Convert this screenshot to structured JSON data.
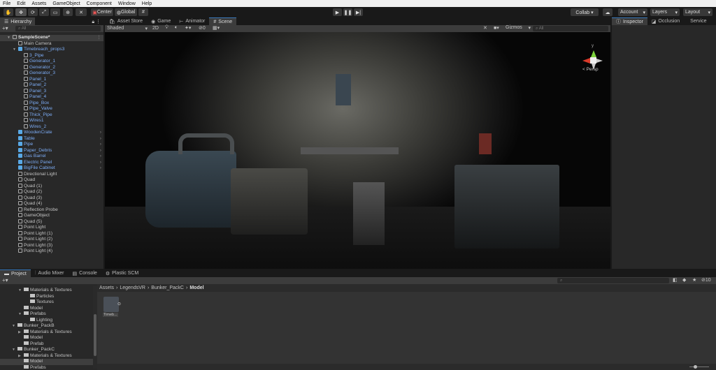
{
  "menu": [
    "File",
    "Edit",
    "Assets",
    "GameObject",
    "Component",
    "Window",
    "Help"
  ],
  "toolbar": {
    "center": "Center",
    "global": "Global",
    "collab": "Collab ▾",
    "account": "Account",
    "layers": "Layers",
    "layout": "Layout"
  },
  "hierarchy": {
    "title": "Hierarchy",
    "search_placeholder": "All",
    "items": [
      {
        "label": "SampleScene*",
        "depth": 0,
        "type": "scene",
        "expanded": true
      },
      {
        "label": "Main Camera",
        "depth": 1,
        "type": "go"
      },
      {
        "label": "Timebreach_props3",
        "depth": 1,
        "type": "prefab",
        "expanded": true
      },
      {
        "label": "3_Pipe",
        "depth": 2,
        "type": "child"
      },
      {
        "label": "Generator_1",
        "depth": 2,
        "type": "child"
      },
      {
        "label": "Generator_2",
        "depth": 2,
        "type": "child"
      },
      {
        "label": "Generator_3",
        "depth": 2,
        "type": "child"
      },
      {
        "label": "Panel_1",
        "depth": 2,
        "type": "child"
      },
      {
        "label": "Panel_2",
        "depth": 2,
        "type": "child"
      },
      {
        "label": "Panel_3",
        "depth": 2,
        "type": "child"
      },
      {
        "label": "Panel_4",
        "depth": 2,
        "type": "child"
      },
      {
        "label": "Pipe_Box",
        "depth": 2,
        "type": "child"
      },
      {
        "label": "Pipe_Valve",
        "depth": 2,
        "type": "child"
      },
      {
        "label": "Thick_Pipe",
        "depth": 2,
        "type": "child"
      },
      {
        "label": "Wires1",
        "depth": 2,
        "type": "child"
      },
      {
        "label": "Wires_2",
        "depth": 2,
        "type": "child"
      },
      {
        "label": "WoodenCrate",
        "depth": 1,
        "type": "prefab",
        "chev": true
      },
      {
        "label": "Table",
        "depth": 1,
        "type": "prefab",
        "chev": true
      },
      {
        "label": "Pipe",
        "depth": 1,
        "type": "prefab",
        "chev": true
      },
      {
        "label": "Paper_Debris",
        "depth": 1,
        "type": "prefab",
        "chev": true
      },
      {
        "label": "Gas Barrel",
        "depth": 1,
        "type": "prefab",
        "chev": true
      },
      {
        "label": "Electric Panel",
        "depth": 1,
        "type": "prefab",
        "chev": true
      },
      {
        "label": "BigFile Cabinet",
        "depth": 1,
        "type": "prefab",
        "chev": true
      },
      {
        "label": "Directional Light",
        "depth": 1,
        "type": "go"
      },
      {
        "label": "Quad",
        "depth": 1,
        "type": "go"
      },
      {
        "label": "Quad (1)",
        "depth": 1,
        "type": "go"
      },
      {
        "label": "Quad (2)",
        "depth": 1,
        "type": "go"
      },
      {
        "label": "Quad (3)",
        "depth": 1,
        "type": "go"
      },
      {
        "label": "Quad (4)",
        "depth": 1,
        "type": "go"
      },
      {
        "label": "Reflection Probe",
        "depth": 1,
        "type": "go"
      },
      {
        "label": "GameObject",
        "depth": 1,
        "type": "go"
      },
      {
        "label": "Quad (5)",
        "depth": 1,
        "type": "go"
      },
      {
        "label": "Point Light",
        "depth": 1,
        "type": "go"
      },
      {
        "label": "Point Light (1)",
        "depth": 1,
        "type": "go"
      },
      {
        "label": "Point Light (2)",
        "depth": 1,
        "type": "go"
      },
      {
        "label": "Point Light (3)",
        "depth": 1,
        "type": "go"
      },
      {
        "label": "Point Light (4)",
        "depth": 1,
        "type": "go"
      }
    ]
  },
  "scene_tabs": [
    "Asset Store",
    "Game",
    "Animator",
    "Scene"
  ],
  "scene_toolbar": {
    "shading": "Shaded",
    "mode2d": "2D",
    "hidden_count": "0",
    "gizmos": "Gizmos",
    "search_placeholder": "All"
  },
  "gizmo": {
    "y_axis": "y",
    "persp": "< Persp"
  },
  "inspector_tabs": [
    "Inspector",
    "Occlusion",
    "Service"
  ],
  "bottom_tabs": [
    "Project",
    "Audio Mixer",
    "Console",
    "Plastic SCM"
  ],
  "project": {
    "tree": [
      {
        "label": "Materials & Textures",
        "depth": 1,
        "open": true
      },
      {
        "label": "Particles",
        "depth": 2
      },
      {
        "label": "Textures",
        "depth": 2
      },
      {
        "label": "Model",
        "depth": 1
      },
      {
        "label": "Prefabs",
        "depth": 1,
        "open": true
      },
      {
        "label": "Lighting",
        "depth": 2
      },
      {
        "label": "Bunker_PackB",
        "depth": 0,
        "open": true
      },
      {
        "label": "Materials & Textures",
        "depth": 1,
        "closed": true
      },
      {
        "label": "Model",
        "depth": 1
      },
      {
        "label": "Prefab",
        "depth": 1
      },
      {
        "label": "Bunker_PackC",
        "depth": 0,
        "open": true
      },
      {
        "label": "Materials & Textures",
        "depth": 1,
        "closed": true
      },
      {
        "label": "Model",
        "depth": 1,
        "selected": true
      },
      {
        "label": "Prefabs",
        "depth": 1
      }
    ],
    "breadcrumb": [
      "Assets",
      "LegendsVR",
      "Bunker_PackC",
      "Model"
    ],
    "asset_label": "Timeb...",
    "hidden_count": "10"
  }
}
